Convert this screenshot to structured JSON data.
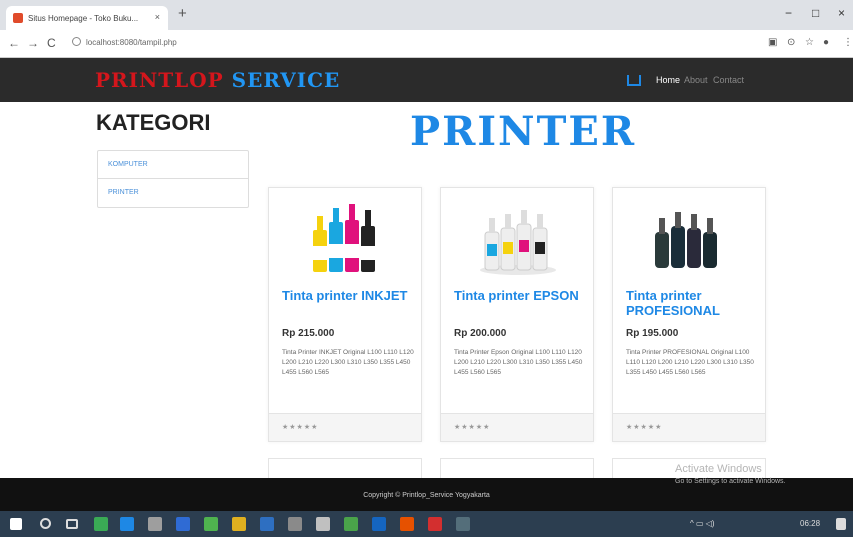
{
  "browser": {
    "tab_title": "Situs Homepage - Toko Buku...",
    "tab_close": "×",
    "new_tab": "+",
    "url": "localhost:8080/tampil.php",
    "nav": {
      "back": "←",
      "forward": "→",
      "reload": "C"
    },
    "window": {
      "minimize": "−",
      "maximize": "□",
      "close": "×"
    }
  },
  "site": {
    "brand_red": "PRINTLOP",
    "brand_blue": "SERVICE",
    "menu": [
      "Home",
      "About",
      "Contact"
    ],
    "colors": {
      "accent": "#1e88e5",
      "brand_red": "#d4161c",
      "nav_bg": "#2b2b2b"
    }
  },
  "sidebar": {
    "title": "KATEGORI",
    "items": [
      "KOMPUTER",
      "PRINTER"
    ]
  },
  "main": {
    "heading": "PRINTER",
    "products": [
      {
        "name": "Tinta printer INKJET",
        "price": "Rp 215.000",
        "desc": "Tinta Printer INKJET Original L100 L110 L120 L200 L210 L220 L300 L310 L350 L355 L450 L455 L560 L565",
        "rating": "★★★★★"
      },
      {
        "name": "Tinta printer EPSON",
        "price": "Rp 200.000",
        "desc": "Tinta Printer Epson Original L100 L110 L120 L200 L210 L220 L300 L310 L350 L355 L450 L455 L560 L565",
        "rating": "★★★★★"
      },
      {
        "name": "Tinta printer PROFESIONAL",
        "price": "Rp 195.000",
        "desc": "Tinta Printer PROFESIONAL Original L100 L110 L120 L200 L210 L220 L300 L310 L350 L355 L450 L455 L560 L565",
        "rating": "★★★★★"
      }
    ]
  },
  "footer": {
    "copyright": "Copyright © Printlop_Service Yogyakarta"
  },
  "os": {
    "watermark_title": "Activate Windows",
    "watermark_sub": "Go to Settings to activate Windows.",
    "clock": "06:28"
  }
}
